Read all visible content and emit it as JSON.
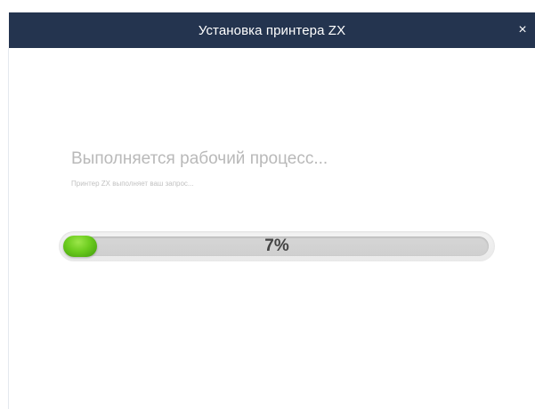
{
  "window": {
    "title": "Установка принтера ZX",
    "close_symbol": "×"
  },
  "status": {
    "main_message": "Выполняется рабочий процесс...",
    "sub_message": "Принтер ZX выполняет ваш запрос..."
  },
  "progress": {
    "value_fraction": 0.07,
    "label": "7%"
  },
  "colors": {
    "titlebar": "#24344f",
    "progress_green": "#6ccc1e",
    "track": "#cfcfcf"
  },
  "icons": {
    "close": "close-icon"
  }
}
